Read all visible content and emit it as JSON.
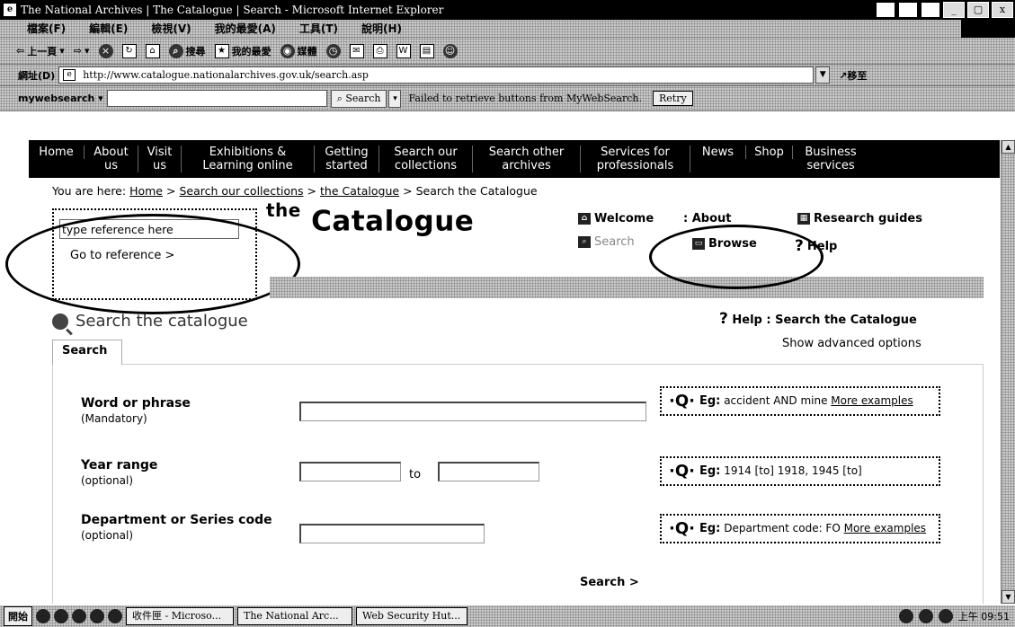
{
  "window": {
    "title": "The National Archives | The Catalogue | Search - Microsoft Internet Explorer",
    "controls": [
      "_",
      "▢",
      "x"
    ]
  },
  "menubar": {
    "items": [
      "檔案(F)",
      "編輯(E)",
      "檢視(V)",
      "我的最愛(A)",
      "工具(T)",
      "說明(H)"
    ]
  },
  "toolbar": {
    "back_label": "上一頁",
    "search_label": "搜尋",
    "favorites_label": "我的最愛",
    "media_label": "媒體"
  },
  "addressbar": {
    "label": "網址(D)",
    "url": "http://www.catalogue.nationalarchives.gov.uk/search.asp",
    "go_label": "移至"
  },
  "websearch": {
    "brand": "mywebsearch",
    "search_button": "Search",
    "error_text": "Failed to retrieve buttons from MyWebSearch.",
    "retry_button": "Retry"
  },
  "sitenav": {
    "items": [
      "Home",
      "About us",
      "Visit us",
      "Exhibitions & Learning online",
      "Getting started",
      "Search our collections",
      "Search other archives",
      "Services for professionals",
      "News",
      "Shop",
      "Business services"
    ]
  },
  "breadcrumb": {
    "prefix": "You are here:",
    "home": "Home",
    "collections": "Search our collections",
    "catalogue": "the Catalogue",
    "current": "Search the Catalogue",
    "separator": ">"
  },
  "reference": {
    "placeholder": "type reference here",
    "button": "Go to reference >"
  },
  "catalogue": {
    "the": "the",
    "word": "Catalogue"
  },
  "toplinks": {
    "welcome": "Welcome",
    "about": ": About",
    "research": "Research guides",
    "search": "Search",
    "browse": "Browse",
    "help": "Help"
  },
  "search_page": {
    "heading": "Search the catalogue",
    "help_prefix": "?",
    "help_link": "Help : Search the Catalogue",
    "advanced": "Show advanced options",
    "tab": "Search",
    "search_button": "Search >"
  },
  "fields": {
    "word": {
      "label": "Word or phrase",
      "sub": "(Mandatory)"
    },
    "year": {
      "label": "Year range",
      "sub": "(optional)",
      "to": "to"
    },
    "dept": {
      "label": "Department or Series code",
      "sub": "(optional)"
    }
  },
  "examples": {
    "word": {
      "eg": "Eg:",
      "text": " accident AND mine ",
      "more": "More examples"
    },
    "year": {
      "eg": "Eg:",
      "text": " 1914 [to] 1918, 1945 [to]"
    },
    "dept": {
      "eg": "Eg:",
      "text": " Department code: FO ",
      "more": "More examples"
    }
  },
  "taskbar": {
    "start": "開始",
    "tasks": [
      "收件匣 - Microso...",
      "The National Arc...",
      "Web Security Hut..."
    ],
    "clock": "上午 09:51"
  }
}
